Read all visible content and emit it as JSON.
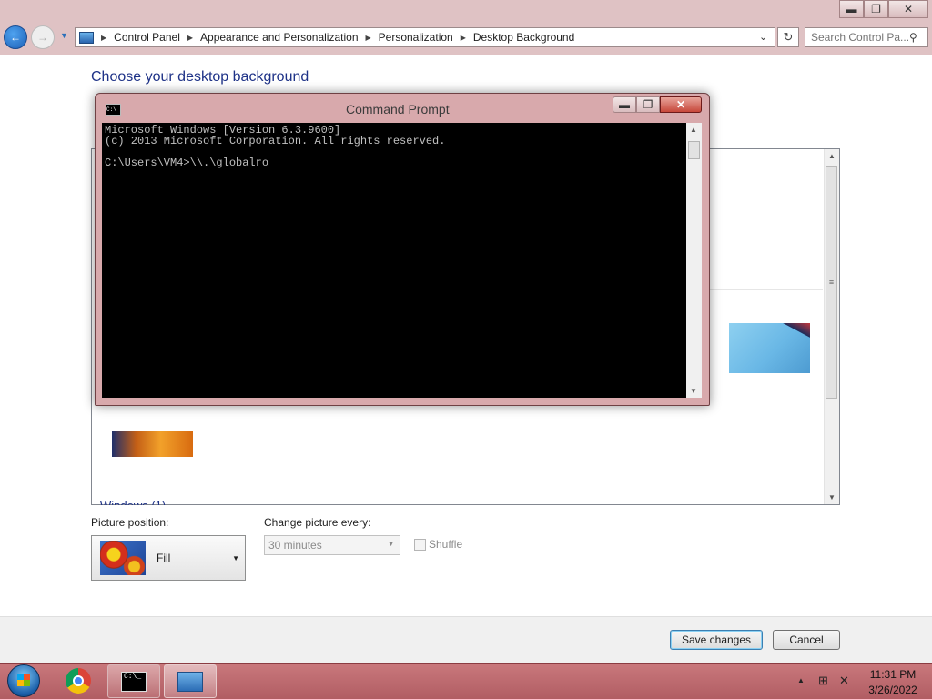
{
  "window": {
    "minimize": "▬",
    "maximize": "❐",
    "close": "✕"
  },
  "nav": {
    "back_icon": "←",
    "forward_icon": "→",
    "history_icon": "▼",
    "breadcrumbs": [
      "Control Panel",
      "Appearance and Personalization",
      "Personalization",
      "Desktop Background"
    ],
    "address_dropdown": "⌄",
    "refresh_icon": "↻",
    "search_placeholder": "Search Control Pa...",
    "search_icon": "⚲"
  },
  "page": {
    "title": "Choose your desktop background",
    "group_header": "Windows (1)"
  },
  "controls": {
    "picture_position_label": "Picture position:",
    "picture_position_value": "Fill",
    "change_interval_label": "Change picture every:",
    "change_interval_value": "30 minutes",
    "shuffle_label": "Shuffle",
    "shuffle_checked": false
  },
  "footer": {
    "save_label": "Save changes",
    "cancel_label": "Cancel"
  },
  "cmd": {
    "icon_text": "C:\\",
    "title": "Command Prompt",
    "minimize": "▬",
    "maximize": "❐",
    "close": "✕",
    "output": "Microsoft Windows [Version 6.3.9600]\n(c) 2013 Microsoft Corporation. All rights reserved.\n\nC:\\Users\\VM4>\\\\.\\globalro"
  },
  "taskbar": {
    "cmd_icon_text": "C:\\_",
    "tray_arrow": "▲",
    "network_icon": "⊞",
    "volume_icon": "✕",
    "time": "11:31 PM",
    "date": "3/26/2022"
  },
  "colors": {
    "accent_title": "#1e3287",
    "titlebar": "#dfc2c4",
    "taskbar": "#b15d63"
  }
}
